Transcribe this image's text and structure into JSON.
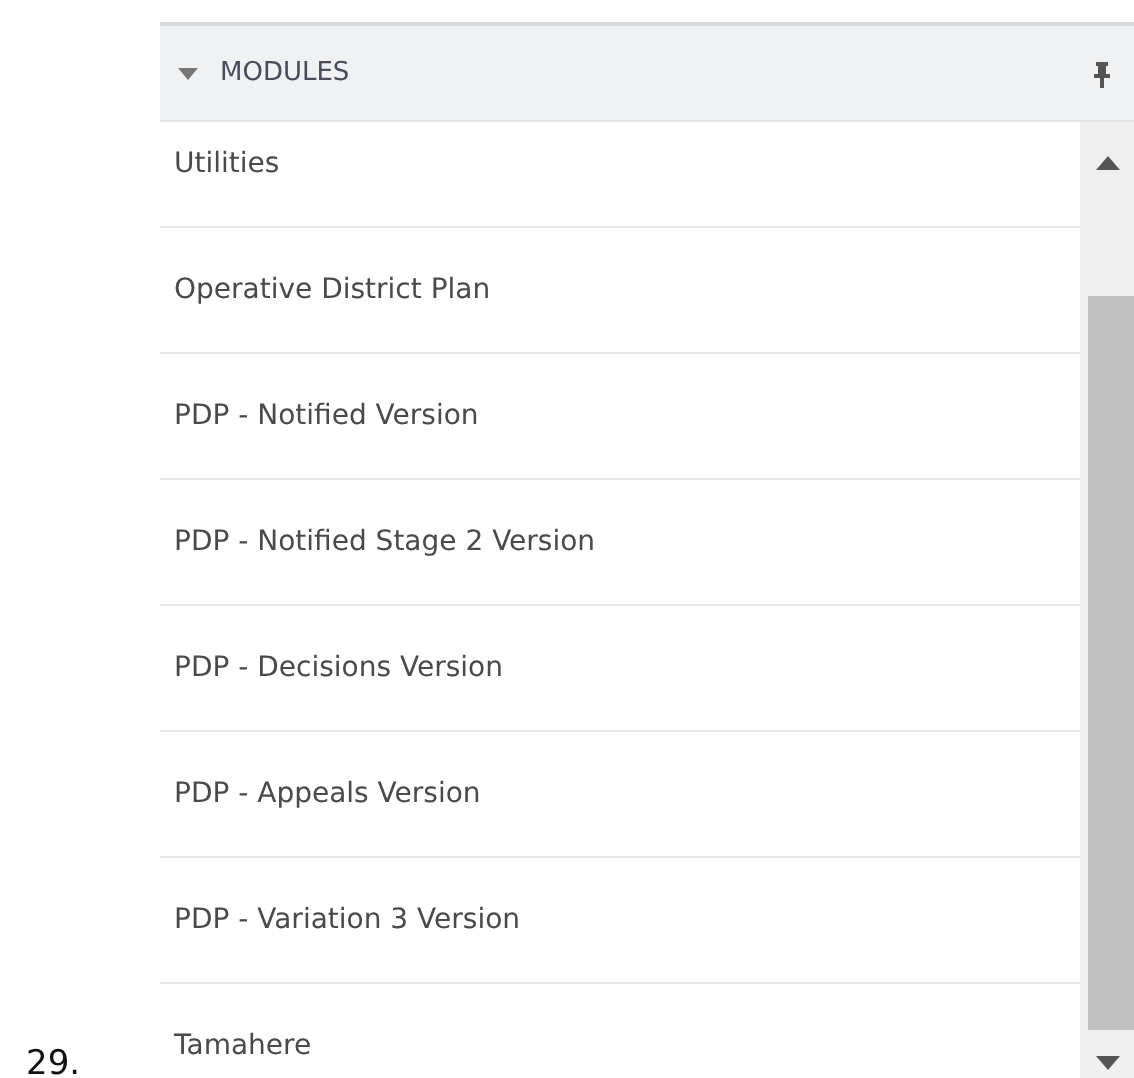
{
  "list_number": "29.",
  "panel": {
    "title": "MODULES",
    "expanded": true,
    "items": [
      {
        "label": "Utilities"
      },
      {
        "label": "Operative District Plan"
      },
      {
        "label": "PDP - Notified Version"
      },
      {
        "label": "PDP - Notified Stage 2 Version"
      },
      {
        "label": "PDP - Decisions Version"
      },
      {
        "label": "PDP - Appeals Version"
      },
      {
        "label": "PDP - Variation 3 Version"
      },
      {
        "label": "Tamahere"
      }
    ]
  }
}
